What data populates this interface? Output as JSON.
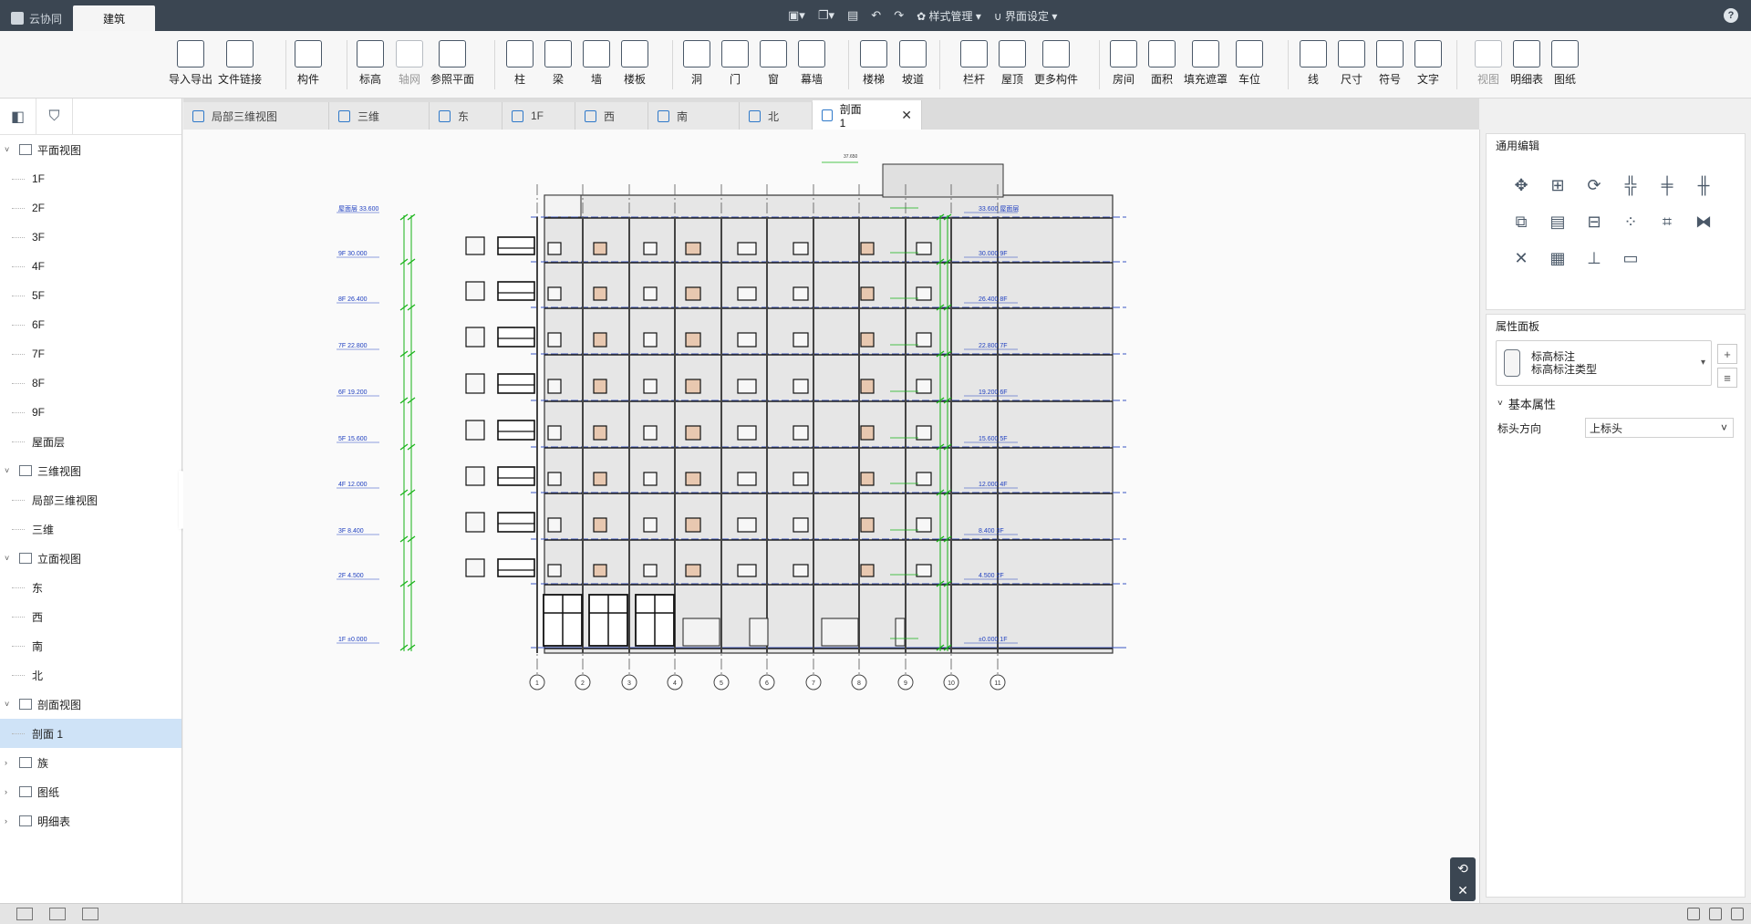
{
  "titlebar": {
    "tabs": [
      {
        "label": "云协同",
        "active": false
      },
      {
        "label": "建筑",
        "active": true
      }
    ],
    "menus": [
      "样式管理",
      "界面设定"
    ],
    "help": "?"
  },
  "ribbon": {
    "buttons": [
      {
        "label": "导入导出",
        "icon": "cad-icon"
      },
      {
        "label": "文件链接",
        "icon": "link-icon"
      },
      {
        "label": "构件",
        "icon": "component-icon"
      },
      {
        "label": "标高",
        "icon": "level-icon"
      },
      {
        "label": "轴网",
        "icon": "grid-icon",
        "dim": true
      },
      {
        "label": "参照平面",
        "icon": "ref-plane-icon"
      },
      {
        "label": "柱",
        "icon": "column-icon"
      },
      {
        "label": "梁",
        "icon": "beam-icon"
      },
      {
        "label": "墙",
        "icon": "wall-icon"
      },
      {
        "label": "楼板",
        "icon": "slab-icon"
      },
      {
        "label": "洞",
        "icon": "opening-icon"
      },
      {
        "label": "门",
        "icon": "door-icon"
      },
      {
        "label": "窗",
        "icon": "window-icon"
      },
      {
        "label": "幕墙",
        "icon": "curtain-wall-icon"
      },
      {
        "label": "楼梯",
        "icon": "stair-icon"
      },
      {
        "label": "坡道",
        "icon": "ramp-icon"
      },
      {
        "label": "栏杆",
        "icon": "railing-icon"
      },
      {
        "label": "屋顶",
        "icon": "roof-icon"
      },
      {
        "label": "更多构件",
        "icon": "more-icon"
      },
      {
        "label": "房间",
        "icon": "room-icon"
      },
      {
        "label": "面积",
        "icon": "area-icon"
      },
      {
        "label": "填充遮罩",
        "icon": "fill-icon"
      },
      {
        "label": "车位",
        "icon": "parking-icon"
      },
      {
        "label": "线",
        "icon": "line-icon"
      },
      {
        "label": "尺寸",
        "icon": "dimension-icon"
      },
      {
        "label": "符号",
        "icon": "symbol-icon"
      },
      {
        "label": "文字",
        "icon": "text-icon"
      },
      {
        "label": "视图",
        "icon": "view-icon",
        "dim": true
      },
      {
        "label": "明细表",
        "icon": "schedule-icon"
      },
      {
        "label": "图纸",
        "icon": "sheet-icon"
      }
    ]
  },
  "tree": {
    "groups": [
      {
        "label": "平面视图",
        "items": [
          "1F",
          "2F",
          "3F",
          "4F",
          "5F",
          "6F",
          "7F",
          "8F",
          "9F",
          "屋面层"
        ]
      },
      {
        "label": "三维视图",
        "items": [
          "局部三维视图",
          "三维"
        ]
      },
      {
        "label": "立面视图",
        "items": [
          "东",
          "西",
          "南",
          "北"
        ]
      },
      {
        "label": "剖面视图",
        "items": [
          "剖面 1"
        ]
      },
      {
        "label": "族",
        "items": []
      },
      {
        "label": "图纸",
        "items": []
      },
      {
        "label": "明细表",
        "items": []
      }
    ],
    "selected": "剖面 1"
  },
  "doctabs": [
    "局部三维视图",
    "三维",
    "东",
    "1F",
    "西",
    "南",
    "北",
    "剖面 1"
  ],
  "active_doctab": "剖面 1",
  "drawing": {
    "top_level": "37.650",
    "roof_note": "33.600",
    "left_levels": [
      "屋面层 33.600",
      "9F 30.000",
      "8F 26.400",
      "7F 22.800",
      "6F 19.200",
      "5F 15.600",
      "4F 12.000",
      "3F 8.400",
      "2F 4.500",
      "1F ±0.000"
    ],
    "right_levels": [
      "33.600 屋面层",
      "30.000 9F",
      "26.400 8F",
      "22.800 7F",
      "19.200 6F",
      "15.600 5F",
      "12.000 4F",
      "8.400 3F",
      "4.500 2F",
      "±0.000 1F"
    ],
    "axes": [
      "1",
      "2",
      "3",
      "4",
      "5",
      "6",
      "7",
      "8",
      "9",
      "10",
      "11"
    ]
  },
  "right": {
    "edit_title": "通用编辑",
    "prop_title": "属性面板",
    "prop_name": "标高标注",
    "prop_type": "标高标注类型",
    "section": "基本属性",
    "prop_key": "标头方向",
    "prop_value": "上标头"
  }
}
